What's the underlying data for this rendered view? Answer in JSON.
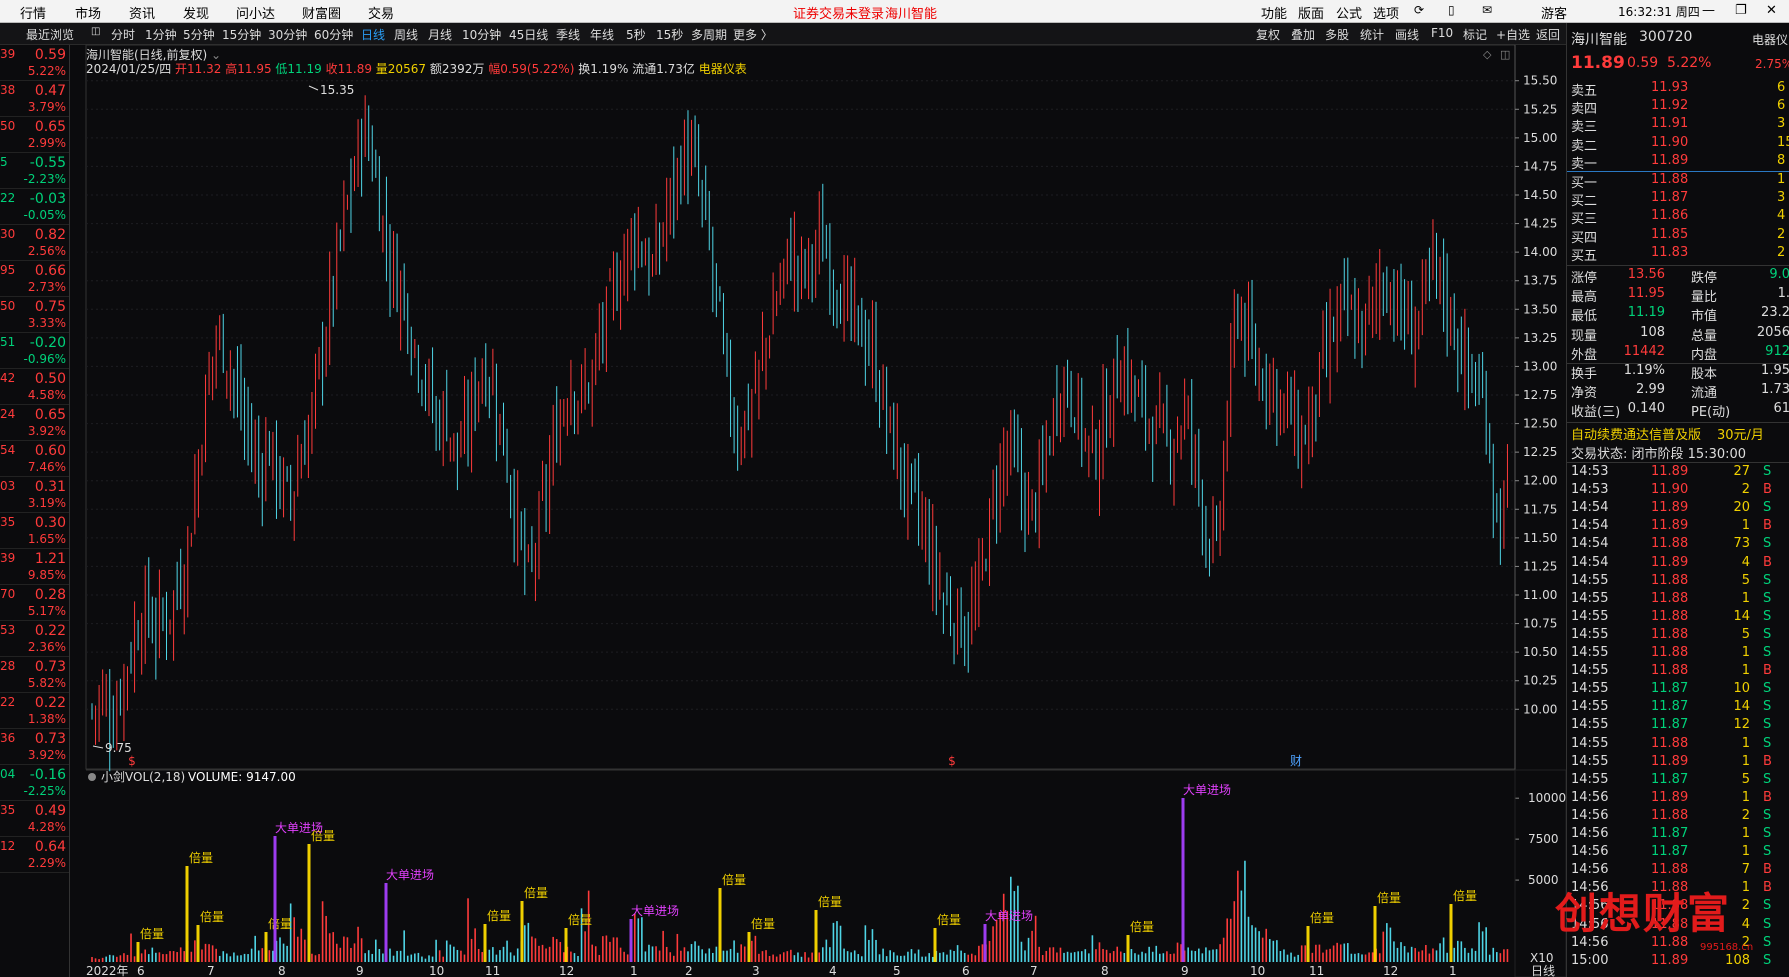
{
  "menu": {
    "items": [
      "行情",
      "市场",
      "资讯",
      "发现",
      "问小达",
      "财富圈",
      "交易"
    ],
    "notice": "证券交易未登录",
    "notice_stock": "海川智能",
    "right_items": [
      "功能",
      "版面",
      "公式",
      "选项"
    ],
    "user": "游客",
    "clock": "16:32:31 周四"
  },
  "toolbar": {
    "left_tabs": [
      "最近浏览"
    ],
    "periods": [
      "分时",
      "1分钟",
      "5分钟",
      "15分钟",
      "30分钟",
      "60分钟",
      "日线",
      "周线",
      "月线",
      "10分钟",
      "45日线",
      "季线",
      "年线",
      "5秒",
      "15秒",
      "多周期",
      "更多 〉"
    ],
    "active_period": "日线",
    "right_items": [
      "复权",
      "叠加",
      "多股",
      "统计",
      "画线",
      "F10",
      "标记",
      "+自选",
      "返回"
    ]
  },
  "leftcol": {
    "rows": [
      {
        "a": "39",
        "b": "0.59",
        "c": "5.22%",
        "color": "red"
      },
      {
        "a": "38",
        "b": "0.47",
        "c": "3.79%",
        "color": "red"
      },
      {
        "a": "50",
        "b": "0.65",
        "c": "2.99%",
        "color": "red"
      },
      {
        "a": "5",
        "b": "-0.55",
        "c": "-2.23%",
        "color": "green"
      },
      {
        "a": "22",
        "b": "-0.03",
        "c": "-0.05%",
        "color": "green"
      },
      {
        "a": "30",
        "b": "0.82",
        "c": "2.56%",
        "color": "red"
      },
      {
        "a": "95",
        "b": "0.66",
        "c": "2.73%",
        "color": "red"
      },
      {
        "a": "50",
        "b": "0.75",
        "c": "3.33%",
        "color": "red"
      },
      {
        "a": "51",
        "b": "-0.20",
        "c": "-0.96%",
        "color": "green"
      },
      {
        "a": "42",
        "b": "0.50",
        "c": "4.58%",
        "color": "red"
      },
      {
        "a": "24",
        "b": "0.65",
        "c": "3.92%",
        "color": "red"
      },
      {
        "a": "54",
        "b": "0.60",
        "c": "7.46%",
        "color": "red"
      },
      {
        "a": "03",
        "b": "0.31",
        "c": "3.19%",
        "color": "red"
      },
      {
        "a": "35",
        "b": "0.30",
        "c": "1.65%",
        "color": "red"
      },
      {
        "a": "39",
        "b": "1.21",
        "c": "9.85%",
        "color": "red"
      },
      {
        "a": "70",
        "b": "0.28",
        "c": "5.17%",
        "color": "red"
      },
      {
        "a": "53",
        "b": "0.22",
        "c": "2.36%",
        "color": "red"
      },
      {
        "a": "28",
        "b": "0.73",
        "c": "5.82%",
        "color": "red"
      },
      {
        "a": "22",
        "b": "0.22",
        "c": "1.38%",
        "color": "red"
      },
      {
        "a": "36",
        "b": "0.73",
        "c": "3.92%",
        "color": "red"
      },
      {
        "a": "04",
        "b": "-0.16",
        "c": "-2.25%",
        "color": "green"
      },
      {
        "a": "35",
        "b": "0.49",
        "c": "4.28%",
        "color": "red"
      },
      {
        "a": "12",
        "b": "0.64",
        "c": "2.29%",
        "color": "red"
      }
    ]
  },
  "chart": {
    "title": "海川智能(日线,前复权)",
    "info": {
      "date": "2024/01/25/四",
      "open": "开11.32",
      "high": "高11.95",
      "low": "低11.19",
      "close": "收11.89",
      "vol": "量20567",
      "amount": "额2392万",
      "amp": "幅0.59(5.22%)",
      "turn": "换1.19%",
      "float": "流通1.73亿",
      "industry": "电器仪表"
    },
    "high_label": "15.35",
    "low_label": "9.75",
    "markers": [
      "$",
      "$",
      "财"
    ],
    "vol_title": "小剑VOL(2,18)",
    "vol_value": "VOLUME: 9147.00",
    "vol_multiplier": "X10",
    "ann_bei": "倍量",
    "ann_big": "大单进场",
    "x_labels": [
      "2022年",
      "6",
      "7",
      "8",
      "9",
      "10",
      "11",
      "12",
      "1",
      "2",
      "3",
      "4",
      "5",
      "6",
      "7",
      "8",
      "9",
      "10",
      "11",
      "12",
      "1"
    ],
    "x_label_last": "日线",
    "price_ticks": [
      "15.50",
      "15.25",
      "15.00",
      "14.75",
      "14.50",
      "14.25",
      "14.00",
      "13.75",
      "13.50",
      "13.25",
      "13.00",
      "12.75",
      "12.50",
      "12.25",
      "12.00",
      "11.75",
      "11.50",
      "11.25",
      "11.00",
      "10.75",
      "10.50",
      "10.25",
      "10.00"
    ],
    "vol_ticks": [
      "10000",
      "7500",
      "5000"
    ]
  },
  "chart_data": {
    "type": "candlestick",
    "y_range": [
      9.6,
      15.55
    ],
    "close_path": [
      10.0,
      10.1,
      9.9,
      10.3,
      10.6,
      10.9,
      10.7,
      10.8,
      11.0,
      11.3,
      12.0,
      12.8,
      13.3,
      13.1,
      12.7,
      12.4,
      12.1,
      12.3,
      12.0,
      11.8,
      12.2,
      12.5,
      13.1,
      13.6,
      14.2,
      14.6,
      15.1,
      14.8,
      14.2,
      13.8,
      13.6,
      13.2,
      12.9,
      12.5,
      12.6,
      12.2,
      12.4,
      12.9,
      13.0,
      12.6,
      12.1,
      11.5,
      11.1,
      11.6,
      12.1,
      12.6,
      12.9,
      12.7,
      12.9,
      13.3,
      13.6,
      13.9,
      14.2,
      14.0,
      13.8,
      14.3,
      14.6,
      14.9,
      14.7,
      14.2,
      13.6,
      12.8,
      12.4,
      12.6,
      12.9,
      13.3,
      13.7,
      14.0,
      13.8,
      13.9,
      14.1,
      13.9,
      13.6,
      13.4,
      13.3,
      13.1,
      12.7,
      12.3,
      12.0,
      11.8,
      11.5,
      11.2,
      10.9,
      10.8,
      10.7,
      10.9,
      11.5,
      12.0,
      12.3,
      12.0,
      11.7,
      11.9,
      12.4,
      12.9,
      12.8,
      12.5,
      12.2,
      12.4,
      12.8,
      13.0,
      12.8,
      12.6,
      12.5,
      12.3,
      12.4,
      12.6,
      12.2,
      11.6,
      11.3,
      12.5,
      13.6,
      13.2,
      12.9,
      13.0,
      12.7,
      12.6,
      12.3,
      12.5,
      12.9,
      13.2,
      13.5,
      13.4,
      13.3,
      13.5,
      13.8,
      13.6,
      13.4,
      13.3,
      13.6,
      13.9,
      13.6,
      13.3,
      13.0,
      12.8,
      12.6,
      11.6,
      11.89
    ],
    "vol_path": [
      300,
      400,
      350,
      900,
      500,
      800,
      650,
      700,
      900,
      1200,
      1400,
      1000,
      800,
      700,
      600,
      1500,
      800,
      700,
      2000,
      3400,
      3000,
      800,
      3200,
      1800,
      1300,
      2500,
      1000,
      800,
      700,
      900,
      600,
      500,
      450,
      700,
      1100,
      700,
      2400,
      800,
      900,
      1100,
      800,
      2300,
      1400,
      900,
      1600,
      800,
      700,
      3400,
      900,
      1500,
      1800,
      800,
      2600,
      1000,
      900,
      800,
      1500,
      1200,
      900,
      1000,
      700,
      800,
      900,
      1600,
      800,
      600,
      700,
      700,
      600,
      700,
      1300,
      2100,
      900,
      700,
      2400,
      800,
      700,
      600,
      700,
      600,
      500,
      700,
      900,
      1000,
      800,
      1200,
      2200,
      3600,
      4800,
      1500,
      1800,
      800,
      900,
      1200,
      900,
      700,
      1400,
      1000,
      800,
      700,
      600,
      800,
      900,
      700,
      1000,
      1500,
      900,
      800,
      1400,
      3200,
      8200,
      2500,
      2200,
      1500,
      800,
      700,
      900,
      1100,
      800,
      2000,
      1300,
      900,
      800,
      700,
      2200,
      1500,
      900,
      800,
      1000,
      1400,
      1200,
      1100,
      900,
      2400,
      900,
      800,
      700
    ]
  },
  "rightpanel": {
    "header_name": "海川智能",
    "header_code": "300720",
    "header_extra": "电器仪",
    "price": "11.89",
    "chg": "0.59",
    "pct": "5.22%",
    "pct2": "2.75%",
    "asks": [
      {
        "label": "卖五",
        "price": "11.93",
        "vol": "6"
      },
      {
        "label": "卖四",
        "price": "11.92",
        "vol": "6"
      },
      {
        "label": "卖三",
        "price": "11.91",
        "vol": "3"
      },
      {
        "label": "卖二",
        "price": "11.90",
        "vol": "15"
      },
      {
        "label": "卖一",
        "price": "11.89",
        "vol": "8"
      }
    ],
    "bids": [
      {
        "label": "买一",
        "price": "11.88",
        "vol": "1"
      },
      {
        "label": "买二",
        "price": "11.87",
        "vol": "3"
      },
      {
        "label": "买三",
        "price": "11.86",
        "vol": "4"
      },
      {
        "label": "买四",
        "price": "11.85",
        "vol": "2"
      },
      {
        "label": "买五",
        "price": "11.83",
        "vol": "2"
      }
    ],
    "stats": [
      {
        "k1": "涨停",
        "v1": "13.56",
        "c1": "red",
        "k2": "跌停",
        "v2": "9.0",
        "c2": "green"
      },
      {
        "k1": "最高",
        "v1": "11.95",
        "c1": "red",
        "k2": "量比",
        "v2": "1.",
        "c2": "wht"
      },
      {
        "k1": "最低",
        "v1": "11.19",
        "c1": "green",
        "k2": "市值",
        "v2": "23.2",
        "c2": "wht"
      },
      {
        "k1": "现量",
        "v1": "108",
        "c1": "wht",
        "k2": "总量",
        "v2": "2056",
        "c2": "wht"
      },
      {
        "k1": "外盘",
        "v1": "11442",
        "c1": "red",
        "k2": "内盘",
        "v2": "912",
        "c2": "green"
      },
      {
        "k1": "换手",
        "v1": "1.19%",
        "c1": "wht",
        "k2": "股本",
        "v2": "1.95",
        "c2": "wht"
      },
      {
        "k1": "净资",
        "v1": "2.99",
        "c1": "wht",
        "k2": "流通",
        "v2": "1.73",
        "c2": "wht"
      },
      {
        "k1": "收益(三)",
        "v1": "0.140",
        "c1": "wht",
        "k2": "PE(动)",
        "v2": "61",
        "c2": "wht"
      }
    ],
    "promo": "自动续费通达信普及版",
    "promo_price": "30元/月",
    "status": "交易状态: 闭市阶段 15:30:00",
    "ticks": [
      {
        "t": "14:53",
        "p": "11.89",
        "v": "27",
        "s": "S"
      },
      {
        "t": "14:53",
        "p": "11.90",
        "v": "2",
        "s": "B"
      },
      {
        "t": "14:54",
        "p": "11.89",
        "v": "20",
        "s": "S"
      },
      {
        "t": "14:54",
        "p": "11.89",
        "v": "1",
        "s": "B"
      },
      {
        "t": "14:54",
        "p": "11.88",
        "v": "73",
        "s": "S"
      },
      {
        "t": "14:54",
        "p": "11.89",
        "v": "4",
        "s": "B"
      },
      {
        "t": "14:55",
        "p": "11.88",
        "v": "5",
        "s": "S"
      },
      {
        "t": "14:55",
        "p": "11.88",
        "v": "1",
        "s": "S"
      },
      {
        "t": "14:55",
        "p": "11.88",
        "v": "14",
        "s": "S"
      },
      {
        "t": "14:55",
        "p": "11.88",
        "v": "5",
        "s": "S"
      },
      {
        "t": "14:55",
        "p": "11.88",
        "v": "1",
        "s": "S"
      },
      {
        "t": "14:55",
        "p": "11.88",
        "v": "1",
        "s": "B"
      },
      {
        "t": "14:55",
        "p": "11.87",
        "v": "10",
        "s": "S"
      },
      {
        "t": "14:55",
        "p": "11.87",
        "v": "14",
        "s": "S"
      },
      {
        "t": "14:55",
        "p": "11.87",
        "v": "12",
        "s": "S"
      },
      {
        "t": "14:55",
        "p": "11.88",
        "v": "1",
        "s": "S"
      },
      {
        "t": "14:55",
        "p": "11.89",
        "v": "1",
        "s": "B"
      },
      {
        "t": "14:55",
        "p": "11.87",
        "v": "5",
        "s": "S"
      },
      {
        "t": "14:56",
        "p": "11.89",
        "v": "1",
        "s": "B"
      },
      {
        "t": "14:56",
        "p": "11.88",
        "v": "2",
        "s": "S"
      },
      {
        "t": "14:56",
        "p": "11.87",
        "v": "1",
        "s": "S"
      },
      {
        "t": "14:56",
        "p": "11.87",
        "v": "1",
        "s": "S"
      },
      {
        "t": "14:56",
        "p": "11.88",
        "v": "7",
        "s": "B"
      },
      {
        "t": "14:56",
        "p": "11.88",
        "v": "1",
        "s": "B"
      },
      {
        "t": "14:56",
        "p": "11.88",
        "v": "2",
        "s": "S"
      },
      {
        "t": "14:56",
        "p": "11.88",
        "v": "4",
        "s": "S"
      },
      {
        "t": "14:56",
        "p": "11.88",
        "v": "2",
        "s": "S"
      },
      {
        "t": "15:00",
        "p": "11.89",
        "v": "108",
        "s": "S"
      }
    ]
  },
  "watermark": "创想财富",
  "watermark_url": "995168.cn"
}
